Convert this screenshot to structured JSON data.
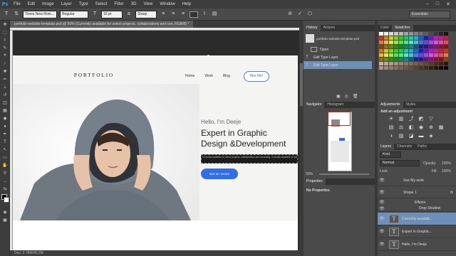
{
  "app": {
    "logo": "Ps"
  },
  "menu": [
    "File",
    "Edit",
    "Image",
    "Layer",
    "Type",
    "Select",
    "Filter",
    "3D",
    "View",
    "Window",
    "Help"
  ],
  "options": {
    "font_family": "Times New Rom...",
    "font_style": "Regular",
    "font_size": "16 pt",
    "antialias": "Sharp",
    "workspace": "Essentials"
  },
  "document": {
    "tab": "portfolio-website-template.psd @ 50% (Currently available for select projects, collaborations and con, RGB/8) *",
    "status": "Doc: 2.78M/40.2M",
    "zoom": "50%"
  },
  "site": {
    "logo": "PORTFOLIO",
    "nav": [
      "Home",
      "Work",
      "Blog"
    ],
    "hire": "Hire Me!",
    "hello": "Hello, I'm Deeje",
    "headline_1": "Expert in Graphic",
    "headline_2": "Design &Development",
    "selected_text": "Currently available for select projects, collaborations and consulting. Currently available for select projects, collaborations and consulting.",
    "button": "SEE MY WORK"
  },
  "history": {
    "tabs": [
      "History",
      "Actions"
    ],
    "file": "portfolio-website-template.psd",
    "items": [
      "Open",
      "Edit Type Layer",
      "Edit Type Layer"
    ]
  },
  "navigator": {
    "tabs": [
      "Navigator",
      "Histogram"
    ],
    "zoom": "50%"
  },
  "properties": {
    "title": "Properties",
    "empty": "No Properties"
  },
  "color": {
    "tabs": [
      "Color",
      "Swatches"
    ]
  },
  "adjustments": {
    "tabs": [
      "Adjustments",
      "Styles"
    ],
    "label": "Add an adjustment"
  },
  "layers": {
    "tabs": [
      "Layers",
      "Channels",
      "Paths"
    ],
    "kind": "Kind",
    "blend": "Normal",
    "opacity_label": "Opacity:",
    "opacity": "100%",
    "lock_label": "Lock:",
    "fill_label": "Fill:",
    "fill": "100%",
    "items": [
      "See My work",
      "Shape 1",
      "Effects",
      "Drop Shadow",
      "Currently availabl...",
      "Expert in Graphic...",
      "Hello, I'm Deeje"
    ]
  },
  "colors": {
    "accent": "#2f6ee8",
    "ps_blue": "#31a8ff",
    "selection": "#6e8fb7"
  }
}
